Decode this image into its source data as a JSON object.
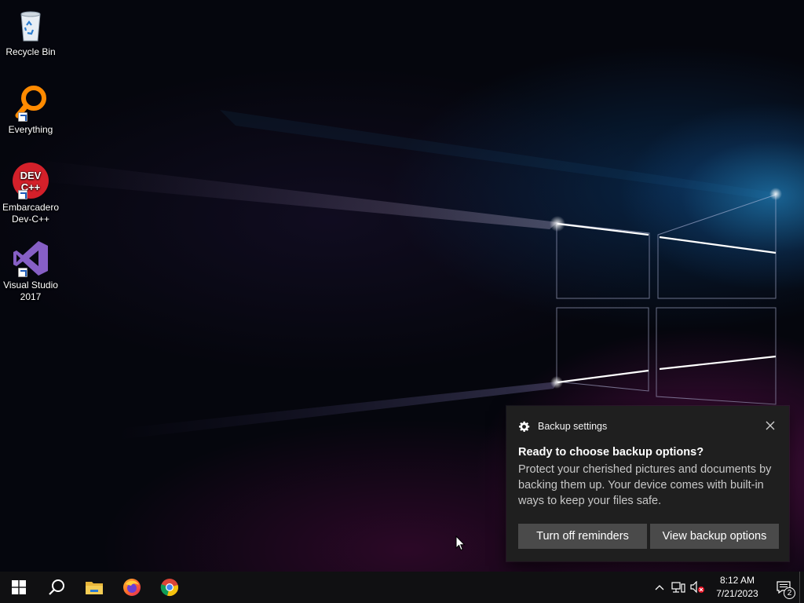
{
  "desktop": {
    "icons": [
      {
        "label": "Recycle Bin",
        "icon": "recycle-bin-icon"
      },
      {
        "label": "Everything",
        "icon": "everything-search-icon"
      },
      {
        "label": "Embarcadero Dev-C++",
        "icon": "devcpp-icon"
      },
      {
        "label": "Visual Studio 2017",
        "icon": "visual-studio-icon"
      }
    ]
  },
  "toast": {
    "app_name": "Backup settings",
    "title": "Ready to choose backup options?",
    "body": "Protect your cherished pictures and documents by backing them up. Your device comes with built-in ways to keep your files safe.",
    "buttons": {
      "turn_off": "Turn off reminders",
      "view": "View backup options"
    },
    "colors": {
      "background": "#1f1f1f",
      "button": "#4a4a4a"
    }
  },
  "taskbar": {
    "pinned": [
      "windows-start-icon",
      "search-icon",
      "file-explorer-icon",
      "firefox-icon",
      "chrome-icon"
    ],
    "clock": {
      "time": "8:12 AM",
      "date": "7/21/2023"
    },
    "notification_count": "2"
  }
}
